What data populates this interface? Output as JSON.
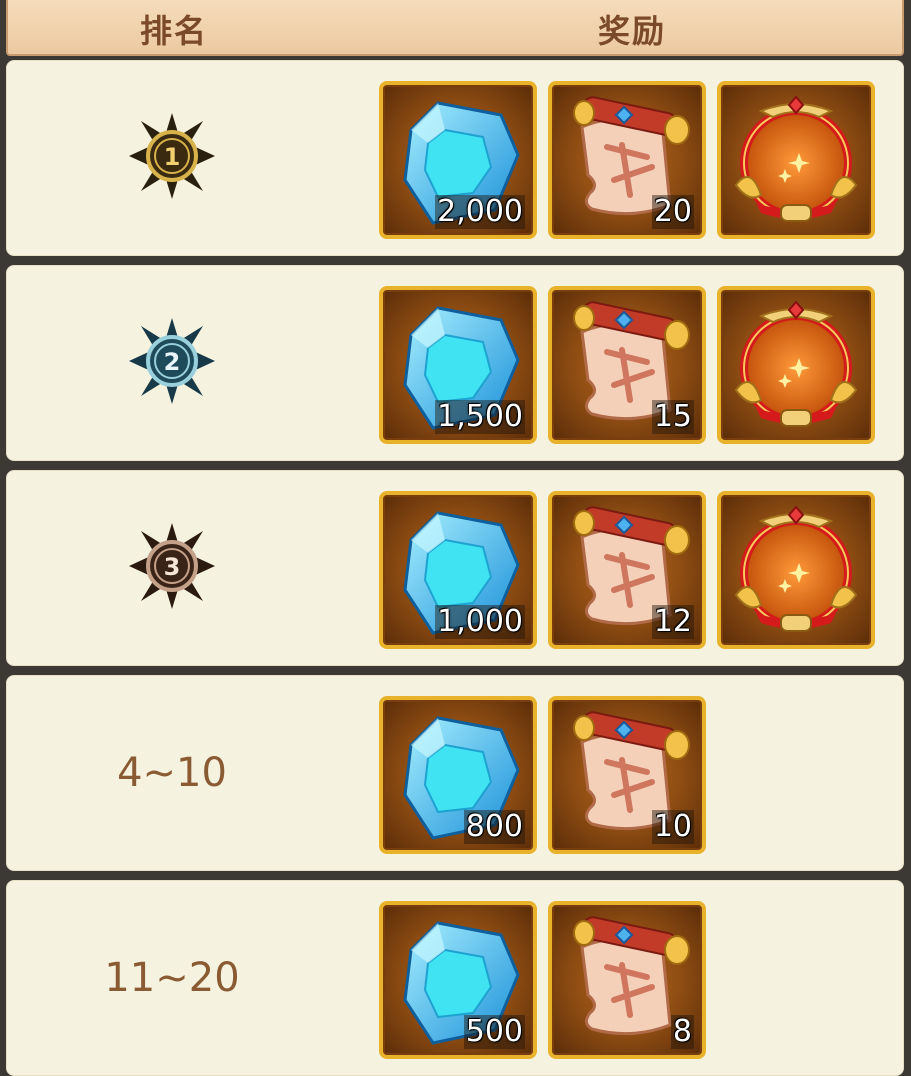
{
  "header": {
    "rank_label": "排名",
    "reward_label": "奖励"
  },
  "rows": [
    {
      "rank_text": "",
      "rank_badge": "rank-1-gold-medal-icon",
      "items": [
        {
          "type": "diamond",
          "count": "2,000"
        },
        {
          "type": "scroll",
          "count": "20"
        },
        {
          "type": "frame",
          "count": ""
        }
      ]
    },
    {
      "rank_text": "",
      "rank_badge": "rank-2-teal-medal-icon",
      "items": [
        {
          "type": "diamond",
          "count": "1,500"
        },
        {
          "type": "scroll",
          "count": "15"
        },
        {
          "type": "frame",
          "count": ""
        }
      ]
    },
    {
      "rank_text": "",
      "rank_badge": "rank-3-bronze-medal-icon",
      "items": [
        {
          "type": "diamond",
          "count": "1,000"
        },
        {
          "type": "scroll",
          "count": "12"
        },
        {
          "type": "frame",
          "count": ""
        }
      ]
    },
    {
      "rank_text": "4~10",
      "items": [
        {
          "type": "diamond",
          "count": "800"
        },
        {
          "type": "scroll",
          "count": "10"
        }
      ]
    },
    {
      "rank_text": "11~20",
      "items": [
        {
          "type": "diamond",
          "count": "500"
        },
        {
          "type": "scroll",
          "count": "8"
        }
      ]
    }
  ],
  "colors": {
    "row_bg": "#f6f2e0",
    "header_bg": "#f2d3ae",
    "item_border": "#e8b22a",
    "rank_text": "#8a5a32"
  }
}
